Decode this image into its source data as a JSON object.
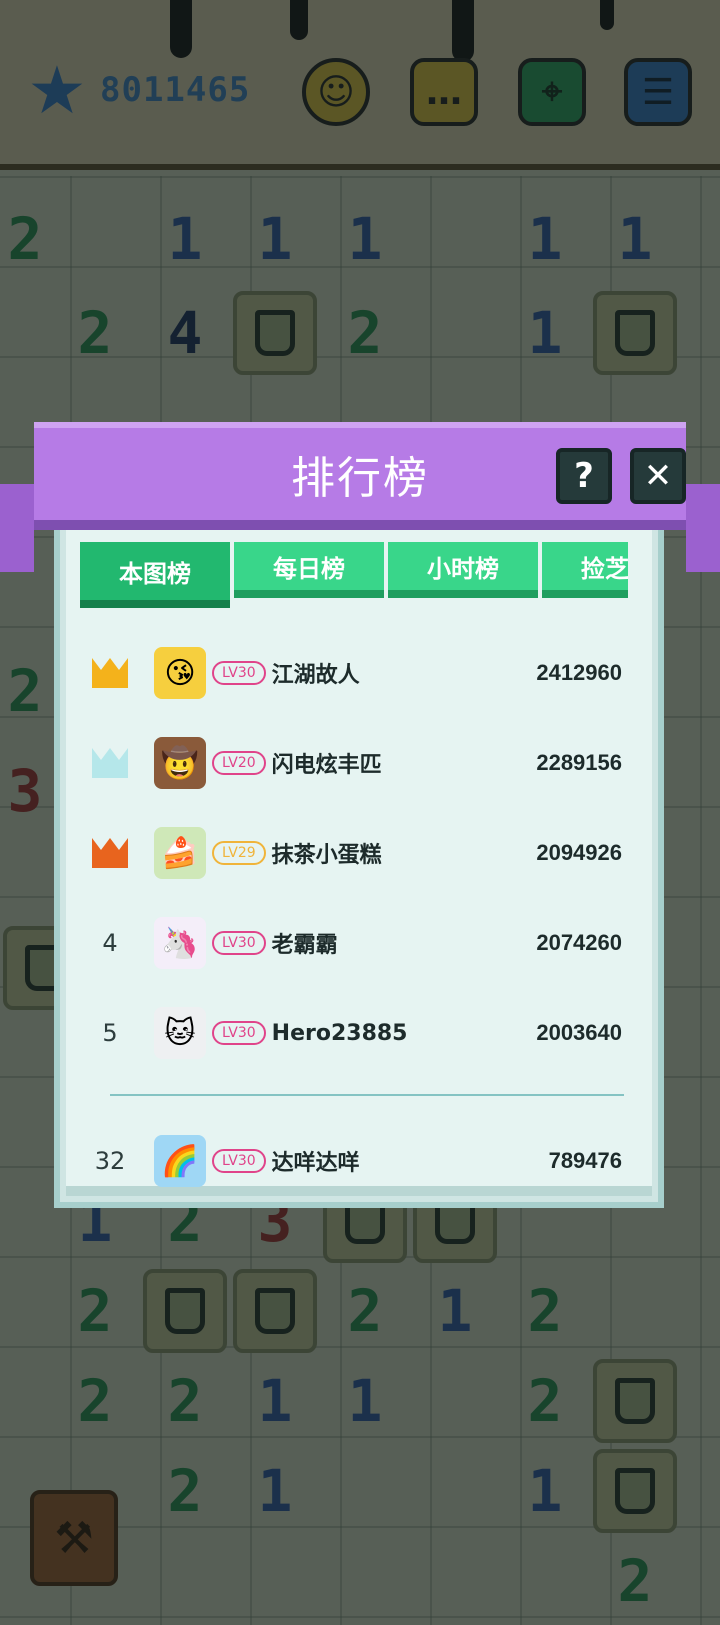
{
  "hud": {
    "score": "8011465",
    "icons": [
      "star-icon",
      "smiley-icon",
      "chat-icon",
      "map-pin-icon",
      "menu-icon"
    ]
  },
  "board": {
    "numbers": [
      {
        "n": "2",
        "c": "#2f9e5c"
      },
      {
        "n": "1",
        "c": "#3a64b6"
      },
      {
        "n": "1",
        "c": "#3a64b6"
      },
      {
        "n": "1",
        "c": "#3a64b6"
      },
      {
        "n": "1",
        "c": "#3a64b6"
      },
      {
        "n": "1",
        "c": "#3a64b6"
      },
      {
        "n": "2",
        "c": "#2f9e5c"
      },
      {
        "n": "4",
        "c": "#24386b"
      },
      {
        "n": "2",
        "c": "#2f9e5c"
      },
      {
        "n": "1",
        "c": "#3a64b6"
      },
      {
        "n": "1",
        "c": "#3a64b6"
      },
      {
        "n": "2",
        "c": "#2f9e5c"
      },
      {
        "n": "3",
        "c": "#b23a3a"
      },
      {
        "n": "1",
        "c": "#3a64b6"
      },
      {
        "n": "2",
        "c": "#2f9e5c"
      },
      {
        "n": "3",
        "c": "#b23a3a"
      },
      {
        "n": "2",
        "c": "#2f9e5c"
      },
      {
        "n": "2",
        "c": "#2f9e5c"
      },
      {
        "n": "1",
        "c": "#3a64b6"
      },
      {
        "n": "2",
        "c": "#2f9e5c"
      },
      {
        "n": "2",
        "c": "#2f9e5c"
      },
      {
        "n": "2",
        "c": "#2f9e5c"
      },
      {
        "n": "1",
        "c": "#3a64b6"
      },
      {
        "n": "2",
        "c": "#2f9e5c"
      },
      {
        "n": "2",
        "c": "#2f9e5c"
      },
      {
        "n": "1",
        "c": "#3a64b6"
      },
      {
        "n": "1",
        "c": "#3a64b6"
      },
      {
        "n": "2",
        "c": "#2f9e5c"
      }
    ]
  },
  "leaderboard": {
    "title": "排行榜",
    "help_label": "?",
    "close_label": "✕",
    "tabs": [
      {
        "label": "本图榜"
      },
      {
        "label": "每日榜"
      },
      {
        "label": "小时榜"
      },
      {
        "label": "捡芝麻"
      }
    ],
    "rows": [
      {
        "rank": "",
        "crown": "gold",
        "avatar": "kiss-emoji-avatar",
        "avatar_glyph": "😘",
        "level": "LV30",
        "name": "江湖故人",
        "score": "2412960"
      },
      {
        "rank": "",
        "crown": "silver",
        "avatar": "cowboy-avatar",
        "avatar_glyph": "🤠",
        "level": "LV20",
        "name": "闪电炫丰匹",
        "score": "2289156"
      },
      {
        "rank": "",
        "crown": "bronze",
        "avatar": "cake-avatar",
        "avatar_glyph": "🍰",
        "level": "LV29",
        "name": "抹茶小蛋糕",
        "score": "2094926"
      },
      {
        "rank": "4",
        "crown": "",
        "avatar": "pony-avatar",
        "avatar_glyph": "🦄",
        "level": "LV30",
        "name": "老霸霸",
        "score": "2074260"
      },
      {
        "rank": "5",
        "crown": "",
        "avatar": "cat-avatar",
        "avatar_glyph": "🐱",
        "level": "LV30",
        "name": "Hero23885",
        "score": "2003640"
      }
    ],
    "me": {
      "rank": "32",
      "avatar": "rainbow-pony-avatar",
      "avatar_glyph": "🌈",
      "level": "LV30",
      "name": "达咩达咩",
      "score": "789476"
    }
  }
}
